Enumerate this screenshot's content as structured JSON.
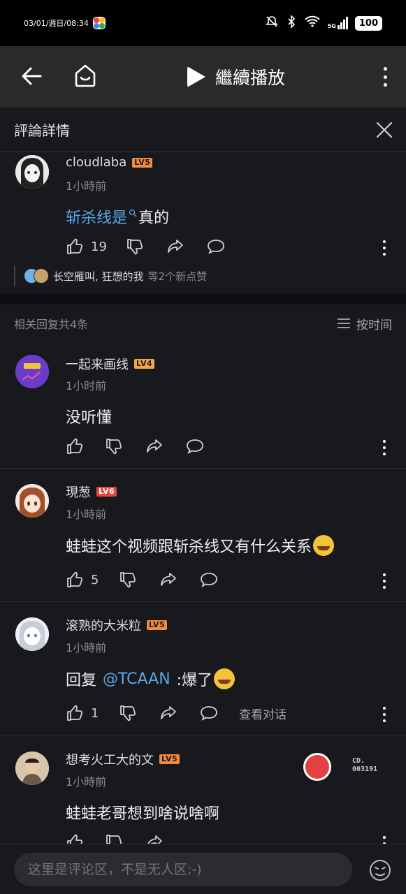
{
  "status_bar": {
    "time": "03/01/週日/08:34",
    "battery": "100",
    "network": "5G"
  },
  "app_bar": {
    "play_label": "繼續播放"
  },
  "detail_header": {
    "title": "評論詳情"
  },
  "root_comment": {
    "username": "cloudlaba",
    "level": "LV5",
    "time": "1小時前",
    "text_link": "斩杀线是",
    "text_rest": "真的",
    "likes": "19",
    "likers_names": "长空雁叫, 狂想的我",
    "likers_suffix": "等2个新点赞"
  },
  "replies": {
    "count_label": "相关回复共4条",
    "sort_label": "按时间",
    "items": [
      {
        "username": "一起来画线",
        "level": "LV4",
        "time": "1小时前",
        "text": "没听懂",
        "likes": ""
      },
      {
        "username": "現葱",
        "level": "LV6",
        "time": "1小時前",
        "text": "蛙蛙这个视频跟斩杀线又有什么关系",
        "likes": "5"
      },
      {
        "username": "滚熟的大米粒",
        "level": "LV5",
        "time": "1小時前",
        "text_prefix": "回复 ",
        "mention": "@TCAAN",
        "text": " :爆了",
        "likes": "1",
        "view_conversation": "查看对话"
      },
      {
        "username": "想考火工大的文",
        "level": "LV5",
        "time": "1小時前",
        "text": "蛙蛙老哥想到啥说啥啊",
        "likes": "",
        "badge_text_1": "CD.",
        "badge_text_2": "003191"
      }
    ]
  },
  "bottom_bar": {
    "input_placeholder": "这里是评论区，不是无人区;-)"
  },
  "colors": {
    "background": "#18191c",
    "link": "#5aa6e6",
    "level_badge": "#f08a3c"
  }
}
